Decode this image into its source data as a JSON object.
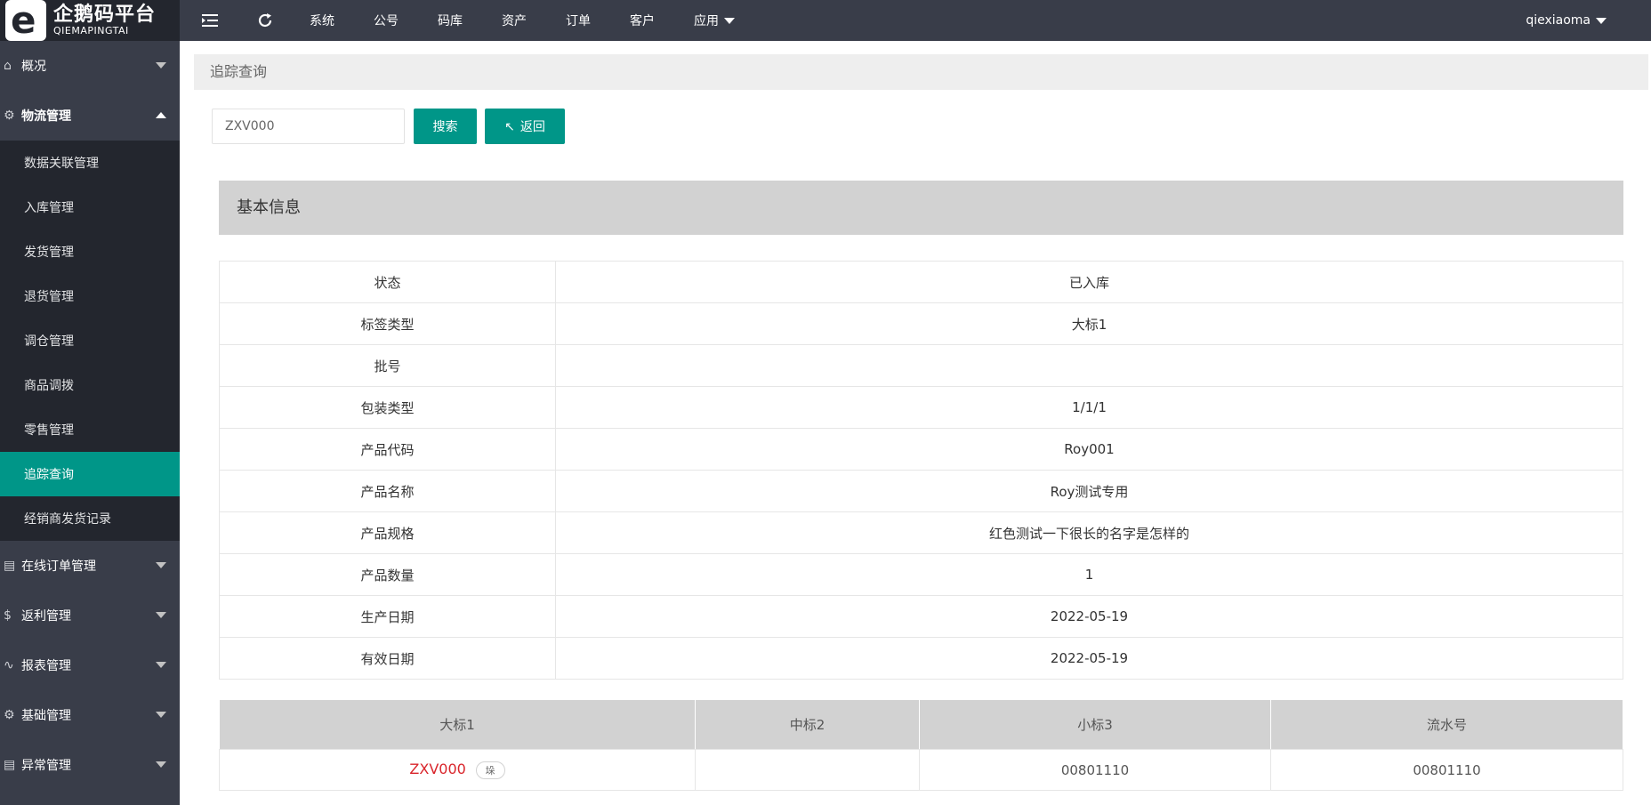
{
  "brand": {
    "name_cn": "企鹅码平台",
    "name_en": "QIEMAPINGTAI"
  },
  "topnav": {
    "items": [
      "系统",
      "公号",
      "码库",
      "资产",
      "订单",
      "客户"
    ],
    "apps_label": "应用",
    "username": "qiexiaoma"
  },
  "sidebar": {
    "overview": "概况",
    "logistics": "物流管理",
    "logistics_items": [
      "数据关联管理",
      "入库管理",
      "发货管理",
      "退货管理",
      "调仓管理",
      "商品调拨",
      "零售管理",
      "追踪查询",
      "经销商发货记录"
    ],
    "online_orders": "在线订单管理",
    "rebate": "返利管理",
    "reports": "报表管理",
    "basic": "基础管理",
    "exceptions": "异常管理"
  },
  "breadcrumb": "追踪查询",
  "search": {
    "value": "ZXV000",
    "button": "搜索",
    "back_button": "返回"
  },
  "info": {
    "header": "基本信息",
    "rows": [
      {
        "label": "状态",
        "value": "已入库"
      },
      {
        "label": "标签类型",
        "value": "大标1"
      },
      {
        "label": "批号",
        "value": ""
      },
      {
        "label": "包装类型",
        "value": "1/1/1"
      },
      {
        "label": "产品代码",
        "value": "Roy001"
      },
      {
        "label": "产品名称",
        "value": "Roy测试专用"
      },
      {
        "label": "产品规格",
        "value": "红色测试一下很长的名字是怎样的"
      },
      {
        "label": "产品数量",
        "value": "1"
      },
      {
        "label": "生产日期",
        "value": "2022-05-19"
      },
      {
        "label": "有效日期",
        "value": "2022-05-19"
      }
    ]
  },
  "codes": {
    "headers": [
      "大标1",
      "中标2",
      "小标3",
      "流水号"
    ],
    "row": {
      "big": "ZXV000",
      "big_tag": "垛",
      "mid": "",
      "small": "00801110",
      "serial": "00801110"
    }
  },
  "colors": {
    "accent": "#009688",
    "topbar": "#393d49",
    "sidebar_dark": "#23262e",
    "code_red": "#d9252b"
  }
}
